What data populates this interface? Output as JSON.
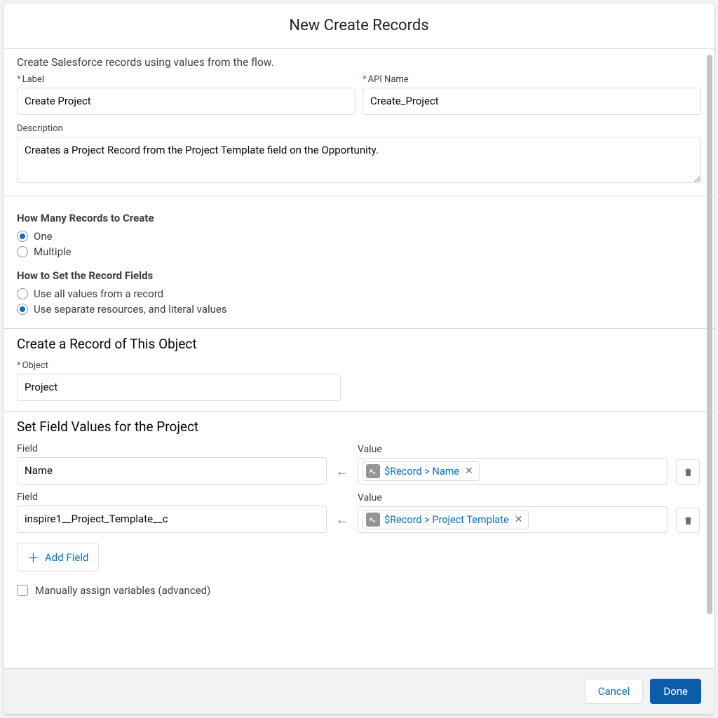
{
  "header": {
    "title": "New Create Records"
  },
  "intro": "Create Salesforce records using values from the flow.",
  "labels": {
    "label": "Label",
    "apiName": "API Name",
    "description": "Description",
    "object": "Object",
    "field": "Field",
    "value": "Value"
  },
  "fields": {
    "label": "Create Project",
    "apiName": "Create_Project",
    "description": "Creates a Project Record from the Project Template field on the Opportunity."
  },
  "howMany": {
    "title": "How Many Records to Create",
    "options": {
      "one": "One",
      "multiple": "Multiple"
    },
    "selected": "one"
  },
  "howSet": {
    "title": "How to Set the Record Fields",
    "options": {
      "all": "Use all values from a record",
      "separate": "Use separate resources, and literal values"
    },
    "selected": "separate"
  },
  "objectSection": {
    "title": "Create a Record of This Object",
    "object": "Project"
  },
  "fieldValues": {
    "title": "Set Field Values for the Project",
    "rows": [
      {
        "field": "Name",
        "value": "$Record > Name"
      },
      {
        "field": "inspire1__Project_Template__c",
        "value": "$Record > Project Template"
      }
    ],
    "addField": "Add Field"
  },
  "advanced": {
    "checkboxLabel": "Manually assign variables (advanced)"
  },
  "footer": {
    "cancel": "Cancel",
    "done": "Done"
  }
}
